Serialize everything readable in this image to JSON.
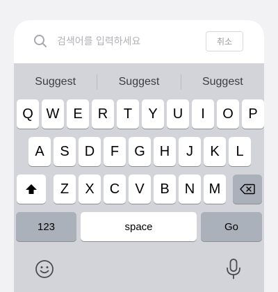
{
  "search": {
    "placeholder": "검색어를 입력하세요",
    "cancel_label": "취소"
  },
  "suggestions": [
    "Suggest",
    "Suggest",
    "Suggest"
  ],
  "keyboard": {
    "row1": [
      "Q",
      "W",
      "E",
      "R",
      "T",
      "Y",
      "U",
      "I",
      "O",
      "P"
    ],
    "row2": [
      "A",
      "S",
      "D",
      "F",
      "G",
      "H",
      "J",
      "K",
      "L"
    ],
    "row3": [
      "Z",
      "X",
      "C",
      "V",
      "B",
      "N",
      "M"
    ],
    "numbers_label": "123",
    "space_label": "space",
    "go_label": "Go"
  },
  "icons": [
    "search-icon",
    "shift-icon",
    "backspace-icon",
    "emoji-icon",
    "microphone-icon"
  ],
  "colors": {
    "keyboard_bg": "#d2d4d9",
    "key_bg": "#ffffff",
    "function_key_bg": "#abb1ba",
    "placeholder": "#b1b1b6"
  }
}
